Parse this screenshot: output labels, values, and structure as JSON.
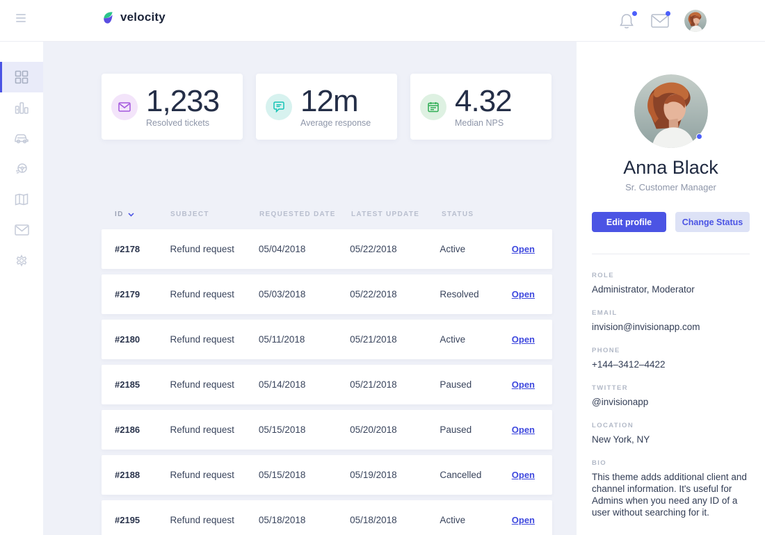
{
  "header": {
    "logo_text": "velocity",
    "icons": {
      "menu": "hamburger-icon",
      "notifications": "bell-icon",
      "messages": "mail-icon",
      "avatar": "user-avatar"
    }
  },
  "sidebar": {
    "items": [
      {
        "name": "dashboard",
        "icon": "dashboard-grid-icon",
        "active": true
      },
      {
        "name": "analytics",
        "icon": "bar-chart-icon",
        "active": false
      },
      {
        "name": "vehicles",
        "icon": "car-icon",
        "active": false
      },
      {
        "name": "trips",
        "icon": "steering-wheel-icon",
        "active": false
      },
      {
        "name": "map",
        "icon": "map-icon",
        "active": false
      },
      {
        "name": "messages",
        "icon": "envelope-icon",
        "active": false
      },
      {
        "name": "settings",
        "icon": "gear-icon",
        "active": false
      }
    ]
  },
  "stats": [
    {
      "value": "1,233",
      "label": "Resolved tickets",
      "icon": "envelope-icon",
      "icon_color": "#a356dd",
      "icon_bg": "#f3e4fa"
    },
    {
      "value": "12m",
      "label": "Average response",
      "icon": "chat-bubble-icon",
      "icon_color": "#15c3b5",
      "icon_bg": "#d7f2ef"
    },
    {
      "value": "4.32",
      "label": "Median NPS",
      "icon": "calendar-icon",
      "icon_color": "#2fae54",
      "icon_bg": "#def1e2"
    }
  ],
  "table": {
    "columns": {
      "id": "ID",
      "subject": "SUBJECT",
      "requested": "REQUESTED DATE",
      "updated": "LATEST UPDATE",
      "status": "STATUS"
    },
    "rows": [
      {
        "id": "#2178",
        "subject": "Refund request",
        "requested": "05/04/2018",
        "updated": "05/22/2018",
        "status": "Active",
        "action": "Open"
      },
      {
        "id": "#2179",
        "subject": "Refund request",
        "requested": "05/03/2018",
        "updated": "05/22/2018",
        "status": "Resolved",
        "action": "Open"
      },
      {
        "id": "#2180",
        "subject": "Refund request",
        "requested": "05/11/2018",
        "updated": "05/21/2018",
        "status": "Active",
        "action": "Open"
      },
      {
        "id": "#2185",
        "subject": "Refund request",
        "requested": "05/14/2018",
        "updated": "05/21/2018",
        "status": "Paused",
        "action": "Open"
      },
      {
        "id": "#2186",
        "subject": "Refund request",
        "requested": "05/15/2018",
        "updated": "05/20/2018",
        "status": "Paused",
        "action": "Open"
      },
      {
        "id": "#2188",
        "subject": "Refund request",
        "requested": "05/15/2018",
        "updated": "05/19/2018",
        "status": "Cancelled",
        "action": "Open"
      },
      {
        "id": "#2195",
        "subject": "Refund request",
        "requested": "05/18/2018",
        "updated": "05/18/2018",
        "status": "Active",
        "action": "Open"
      }
    ]
  },
  "profile": {
    "name": "Anna Black",
    "title": "Sr. Customer Manager",
    "edit_button": "Edit profile",
    "status_button": "Change Status",
    "fields": {
      "role": {
        "label": "Role",
        "value": "Administrator, Moderator"
      },
      "email": {
        "label": "Email",
        "value": "invision@invisionapp.com"
      },
      "phone": {
        "label": "Phone",
        "value": "+144–3412–4422"
      },
      "twitter": {
        "label": "Twitter",
        "value": "@invisionapp"
      },
      "location": {
        "label": "Location",
        "value": "New York, NY"
      },
      "bio": {
        "label": "Bio",
        "value": "This theme adds additional client and channel information. It's useful for Admins when you need any ID of a user without searching for it."
      }
    }
  },
  "colors": {
    "accent": "#4b54e4",
    "notification_dot": "#4c5ffa",
    "main_bg": "#eff1f8",
    "leaf_green": "#2bc48a",
    "leaf_purple": "#5b4ee1"
  }
}
